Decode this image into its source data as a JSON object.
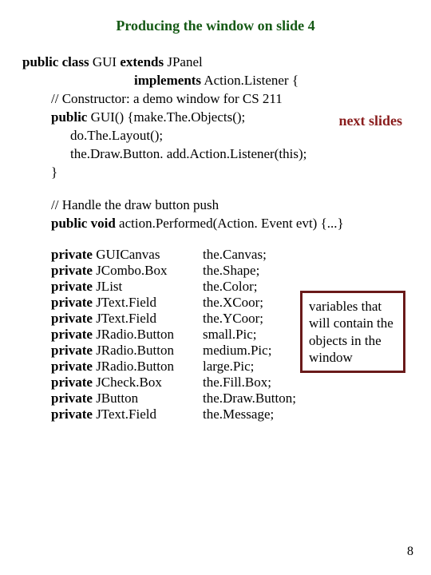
{
  "title": "Producing the window on slide 4",
  "next_slides_label": "next slides",
  "code": {
    "l1a": "public class",
    "l1b": " GUI ",
    "l1c": "extends",
    "l1d": " JPanel",
    "l2a": "implements",
    "l2b": " Action.Listener {",
    "l3": "// Constructor: a demo window for CS 211",
    "l4a": "public",
    "l4b": " GUI() {make.The.Objects();",
    "l5": "do.The.Layout();",
    "l6": "the.Draw.Button. add.Action.Listener(this);",
    "l7": "}",
    "l8": "// Handle the draw button push",
    "l9a": "public void",
    "l9b": " action.Performed(Action. Event evt) {...}"
  },
  "decls": [
    {
      "kw": "private",
      "type": " GUICanvas",
      "name": "the.Canvas;"
    },
    {
      "kw": "private",
      "type": " JCombo.Box",
      "name": "the.Shape;"
    },
    {
      "kw": "private",
      "type": " JList",
      "name": "the.Color;"
    },
    {
      "kw": "private",
      "type": " JText.Field",
      "name": "the.XCoor;"
    },
    {
      "kw": "private",
      "type": " JText.Field",
      "name": "the.YCoor;"
    },
    {
      "kw": "private",
      "type": " JRadio.Button",
      "name": "small.Pic;"
    },
    {
      "kw": "private",
      "type": " JRadio.Button",
      "name": "medium.Pic;"
    },
    {
      "kw": "private",
      "type": " JRadio.Button",
      "name": "large.Pic;"
    },
    {
      "kw": "private",
      "type": " JCheck.Box",
      "name": "the.Fill.Box;"
    },
    {
      "kw": "private",
      "type": " JButton",
      "name": "the.Draw.Button;"
    },
    {
      "kw": "private",
      "type": " JText.Field",
      "name": "the.Message;"
    }
  ],
  "vars_note": "variables that will contain the objects in the window",
  "page_number": "8"
}
